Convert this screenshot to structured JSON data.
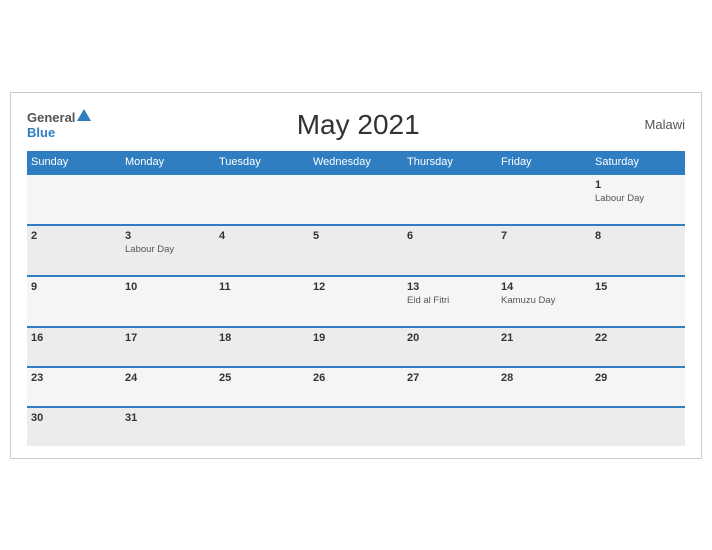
{
  "header": {
    "logo_general": "General",
    "logo_blue": "Blue",
    "title": "May 2021",
    "country": "Malawi"
  },
  "weekdays": [
    "Sunday",
    "Monday",
    "Tuesday",
    "Wednesday",
    "Thursday",
    "Friday",
    "Saturday"
  ],
  "weeks": [
    [
      {
        "day": "",
        "holiday": ""
      },
      {
        "day": "",
        "holiday": ""
      },
      {
        "day": "",
        "holiday": ""
      },
      {
        "day": "",
        "holiday": ""
      },
      {
        "day": "",
        "holiday": ""
      },
      {
        "day": "",
        "holiday": ""
      },
      {
        "day": "1",
        "holiday": "Labour Day"
      }
    ],
    [
      {
        "day": "2",
        "holiday": ""
      },
      {
        "day": "3",
        "holiday": "Labour Day"
      },
      {
        "day": "4",
        "holiday": ""
      },
      {
        "day": "5",
        "holiday": ""
      },
      {
        "day": "6",
        "holiday": ""
      },
      {
        "day": "7",
        "holiday": ""
      },
      {
        "day": "8",
        "holiday": ""
      }
    ],
    [
      {
        "day": "9",
        "holiday": ""
      },
      {
        "day": "10",
        "holiday": ""
      },
      {
        "day": "11",
        "holiday": ""
      },
      {
        "day": "12",
        "holiday": ""
      },
      {
        "day": "13",
        "holiday": "Eid al Fitri"
      },
      {
        "day": "14",
        "holiday": "Kamuzu Day"
      },
      {
        "day": "15",
        "holiday": ""
      }
    ],
    [
      {
        "day": "16",
        "holiday": ""
      },
      {
        "day": "17",
        "holiday": ""
      },
      {
        "day": "18",
        "holiday": ""
      },
      {
        "day": "19",
        "holiday": ""
      },
      {
        "day": "20",
        "holiday": ""
      },
      {
        "day": "21",
        "holiday": ""
      },
      {
        "day": "22",
        "holiday": ""
      }
    ],
    [
      {
        "day": "23",
        "holiday": ""
      },
      {
        "day": "24",
        "holiday": ""
      },
      {
        "day": "25",
        "holiday": ""
      },
      {
        "day": "26",
        "holiday": ""
      },
      {
        "day": "27",
        "holiday": ""
      },
      {
        "day": "28",
        "holiday": ""
      },
      {
        "day": "29",
        "holiday": ""
      }
    ],
    [
      {
        "day": "30",
        "holiday": ""
      },
      {
        "day": "31",
        "holiday": ""
      },
      {
        "day": "",
        "holiday": ""
      },
      {
        "day": "",
        "holiday": ""
      },
      {
        "day": "",
        "holiday": ""
      },
      {
        "day": "",
        "holiday": ""
      },
      {
        "day": "",
        "holiday": ""
      }
    ]
  ]
}
